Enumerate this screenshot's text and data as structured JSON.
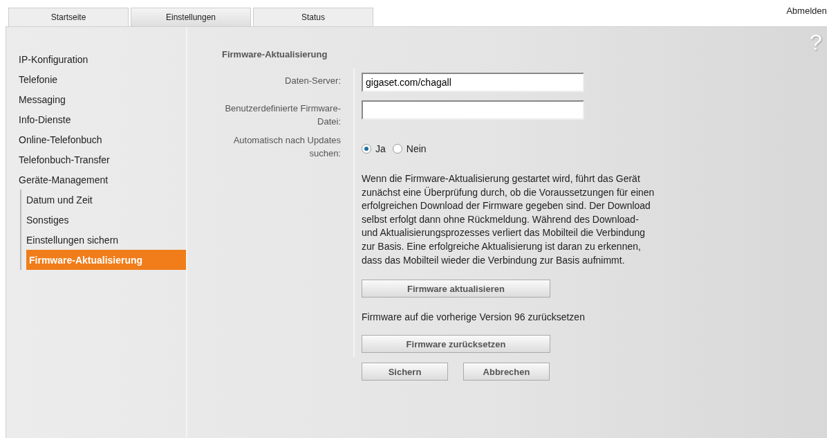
{
  "tabs": [
    {
      "label": "Startseite",
      "selected": false
    },
    {
      "label": "Einstellungen",
      "selected": true
    },
    {
      "label": "Status",
      "selected": false
    }
  ],
  "logout": "Abmelden",
  "help": "?",
  "sidebar": {
    "items": [
      {
        "label": "IP-Konfiguration",
        "selected": false
      },
      {
        "label": "Telefonie",
        "selected": false
      },
      {
        "label": "Messaging",
        "selected": false
      },
      {
        "label": "Info-Dienste",
        "selected": false
      },
      {
        "label": "Online-Telefonbuch",
        "selected": false
      },
      {
        "label": "Telefonbuch-Transfer",
        "selected": false
      },
      {
        "label": "Geräte-Management",
        "selected": false,
        "children": [
          {
            "label": "Datum und Zeit",
            "selected": false
          },
          {
            "label": "Sonstiges",
            "selected": false
          },
          {
            "label": "Einstellungen sichern",
            "selected": false
          },
          {
            "label": "Firmware-Aktualisierung",
            "selected": true
          }
        ]
      }
    ]
  },
  "section_title": "Firmware-Aktualisierung",
  "fields": [
    {
      "label": "Daten-Server:",
      "value": "gigaset.com/chagall"
    },
    {
      "label": "Benutzerdefinierte Firmware-Datei:"
    }
  ],
  "auto_update": {
    "label": "Automatisch nach Updates suchen:",
    "options": [
      {
        "label": "Ja",
        "selected": true
      },
      {
        "label": "Nein",
        "selected": false
      }
    ]
  },
  "description": "Wenn die Firmware-Aktualisierung gestartet wird, führt das Gerät zunächst eine Überprüfung durch, ob die Voraussetzungen für einen erfolgreichen Download der Firmware gegeben sind. Der Download selbst erfolgt dann ohne Rückmeldung. Während des Download- und Aktualisierungsprozesses verliert das Mobilteil die Verbindung zur Basis. Eine erfolgreiche Aktualisierung ist daran zu erkennen, dass das Mobilteil wieder die Verbindung zur Basis aufnimmt.",
  "update_button": "Firmware aktualisieren",
  "revert_text": "Firmware auf die vorherige Version 96 zurücksetzen",
  "revert_button": "Firmware zurücksetzen",
  "buttons": [
    "Sichern",
    "Abbrechen"
  ]
}
